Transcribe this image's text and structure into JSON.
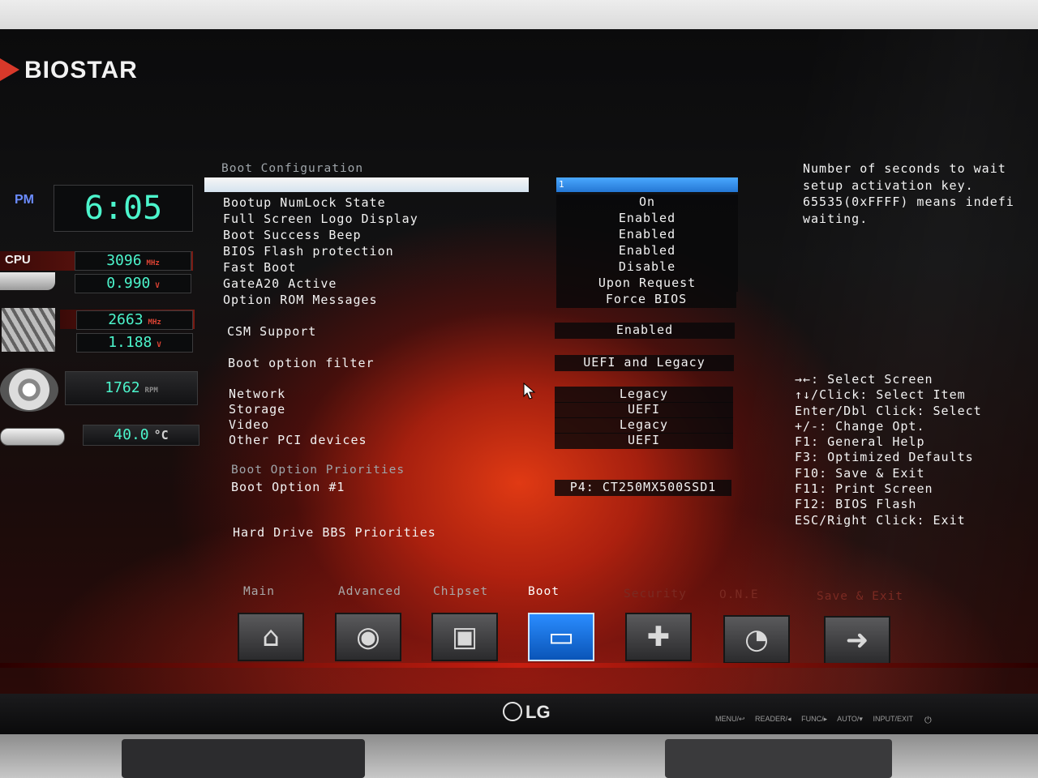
{
  "brand": {
    "name": "BIOSTAR"
  },
  "hardware": {
    "time_period": "PM",
    "time": "6:05",
    "cpu_label": "CPU",
    "cpu_freq": "3096",
    "cpu_freq_unit": "MHz",
    "cpu_volt": "0.990",
    "cpu_volt_unit": "V",
    "mem_freq": "2663",
    "mem_freq_unit": "MHz",
    "mem_volt": "1.188",
    "mem_volt_unit": "V",
    "fan_rpm": "1762",
    "fan_unit": "RPM",
    "temp": "40.0",
    "temp_unit": "°C"
  },
  "boot_config": {
    "title": "Boot Configuration",
    "selected_value": "1",
    "items": [
      {
        "label": "Bootup NumLock State",
        "value": "On"
      },
      {
        "label": "Full Screen Logo Display",
        "value": "Enabled"
      },
      {
        "label": "Boot Success Beep",
        "value": "Enabled"
      },
      {
        "label": "BIOS Flash protection",
        "value": "Enabled"
      },
      {
        "label": "Fast Boot",
        "value": "Disable"
      },
      {
        "label": "GateA20 Active",
        "value": "Upon Request"
      },
      {
        "label": "Option ROM Messages",
        "value": "Force BIOS"
      }
    ],
    "csm_label": "CSM Support",
    "csm_value": "Enabled",
    "filter_label": "Boot option filter",
    "filter_value": "UEFI and Legacy",
    "devices": [
      {
        "label": "Network",
        "value": "Legacy"
      },
      {
        "label": "Storage",
        "value": "UEFI"
      },
      {
        "label": "Video",
        "value": "Legacy"
      },
      {
        "label": "Other PCI devices",
        "value": "UEFI"
      }
    ],
    "priorities_title": "Boot Option Priorities",
    "boot_option_label": "Boot Option #1",
    "boot_option_value": "P4: CT250MX500SSD1",
    "hdd_bbs": "Hard Drive BBS Priorities"
  },
  "help": {
    "text": "Number of seconds to wait\nsetup activation key.\n65535(0xFFFF) means indefi\nwaiting."
  },
  "keys": [
    "→←: Select Screen",
    "↑↓/Click: Select Item",
    "Enter/Dbl Click: Select",
    "+/-: Change Opt.",
    "F1: General Help",
    "F3: Optimized Defaults",
    "F10: Save & Exit",
    "F11: Print Screen",
    "F12: BIOS Flash",
    "ESC/Right Click: Exit"
  ],
  "tabs": [
    {
      "label": "Main",
      "icon": "home-icon"
    },
    {
      "label": "Advanced",
      "icon": "joystick-icon"
    },
    {
      "label": "Chipset",
      "icon": "chip-icon"
    },
    {
      "label": "Boot",
      "icon": "drive-icon"
    },
    {
      "label": "Security",
      "icon": "shield-icon"
    },
    {
      "label": "O.N.E",
      "icon": "gauge-icon"
    },
    {
      "label": "Save & Exit",
      "icon": "folder-exit-icon"
    }
  ],
  "monitor": {
    "brand": "LG",
    "buttons": "MENU/↩ READER/◂ FUNC/▸ AUTO/▾ INPUT/EXIT"
  }
}
